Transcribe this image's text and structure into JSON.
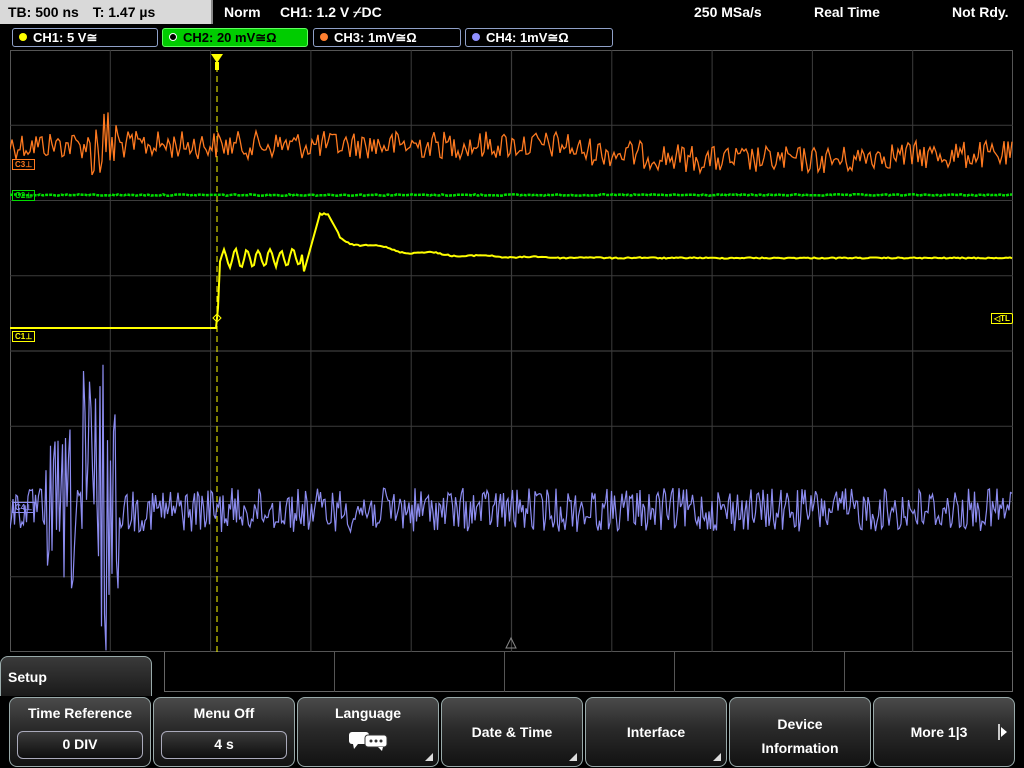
{
  "status_bar": {
    "timebase": "TB: 500 ns",
    "trigger_time": "T: 1.47 µs",
    "acq_mode": "Norm",
    "trigger_setting": "CH1: 1.2 V ⌿DC",
    "sample_rate": "250 MSa/s",
    "mode": "Real Time",
    "state": "Not Rdy."
  },
  "channels": [
    {
      "label": "CH1: 5 V≅",
      "color": "#ffff00",
      "active": false
    },
    {
      "label": "CH2: 20 mV≅Ω",
      "color": "#00ff00",
      "active": true
    },
    {
      "label": "CH3: 1mV≅Ω",
      "color": "#ff8030",
      "active": false
    },
    {
      "label": "CH4: 1mV≅Ω",
      "color": "#9090ff",
      "active": false
    }
  ],
  "markers": {
    "c3": "C3",
    "c2": "C2",
    "c1": "C1",
    "c4": "C4",
    "trigger_level": "TL"
  },
  "colors": {
    "ch1": "#ffff00",
    "ch2": "#00dd00",
    "ch3": "#ff7a20",
    "ch4": "#8c8cf0",
    "grid": "#3c3c3c"
  },
  "menu": {
    "title": "Setup",
    "softkeys": [
      {
        "label": "Time Reference",
        "value": "0 DIV",
        "icon": ""
      },
      {
        "label": "Menu Off",
        "value": "4 s",
        "icon": ""
      },
      {
        "label": "Language",
        "value": "",
        "icon": "speech-bubbles-icon"
      },
      {
        "label": "Date & Time",
        "value": "",
        "icon": ""
      },
      {
        "label": "Interface",
        "value": "",
        "icon": ""
      },
      {
        "label": "Device Information",
        "value": "",
        "icon": ""
      },
      {
        "label": "More 1|3",
        "value": "",
        "icon": "arrow-right-icon"
      }
    ]
  }
}
